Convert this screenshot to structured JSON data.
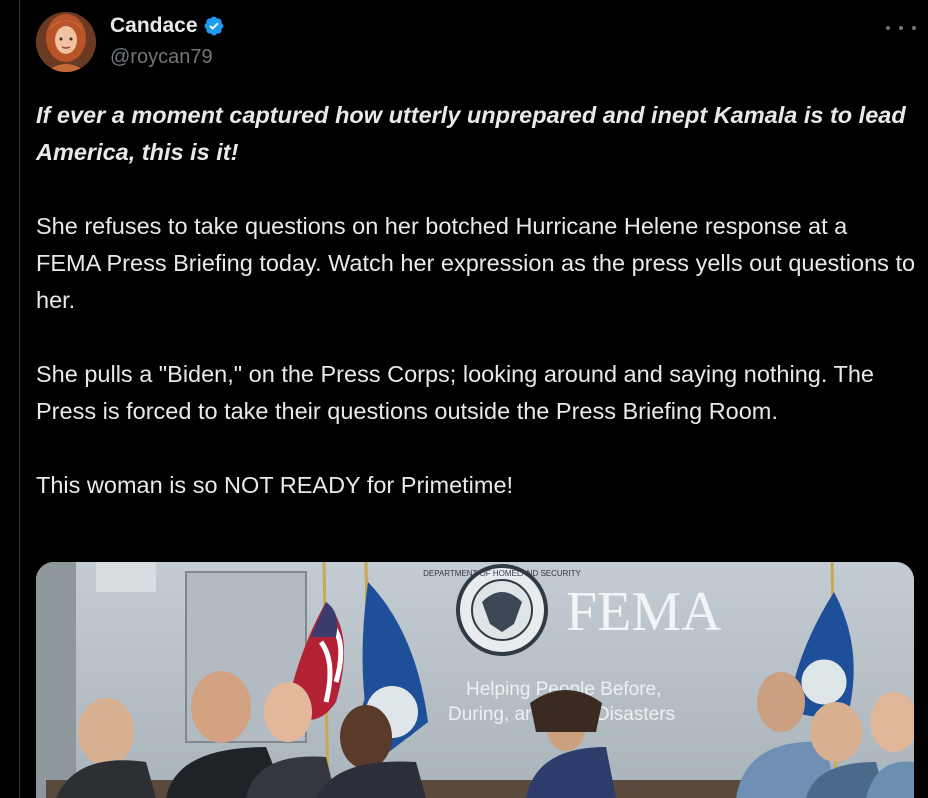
{
  "author": {
    "display_name": "Candace",
    "handle": "@roycan79",
    "verified": true
  },
  "icons": {
    "avatar": "profile-photo-woman-red-hair",
    "verified": "verified-badge-icon",
    "more": "more-dots-icon"
  },
  "tweet": {
    "lead": "If ever a moment captured how utterly unprepared and inept Kamala is to lead America, this is it!",
    "paragraphs": [
      "She refuses to take questions on her botched Hurricane Helene response at a FEMA Press Briefing today. Watch her expression as the press yells out questions to her.",
      "She pulls a \"Biden,\" on the Press Corps; looking around and saying nothing. The Press is forced to take their questions outside the Press Briefing Room.",
      "This woman is so NOT READY for Primetime!"
    ]
  },
  "media": {
    "wall_logo": "FEMA",
    "wall_slogan_line1": "Helping People Before,",
    "wall_slogan_line2": "During, and After Disasters",
    "seal_text": "DEPARTMENT OF HOMELAND SECURITY"
  },
  "colors": {
    "background": "#000000",
    "text": "#e7e9ea",
    "secondary": "#71767b",
    "verified_blue": "#1d9bf0"
  }
}
